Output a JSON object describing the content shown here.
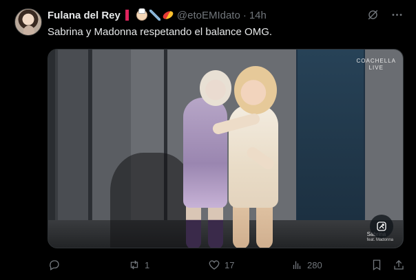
{
  "tweet": {
    "author": {
      "display_name": "Fulana del Rey",
      "name_emojis": [
        "red-boot",
        "nurse-face",
        "syringe",
        "pill"
      ],
      "handle": "@etoEMIdato",
      "separator": "·",
      "time": "14h"
    },
    "text": "Sabrina y Madonna respetando el balance OMG.",
    "media": {
      "watermark_top_line1": "COACHELLA",
      "watermark_top_line2": "LIVE",
      "watermark_bottom_line1": "Sabrina",
      "watermark_bottom_line2": "feat. Madonna",
      "alt_button_icon": "image-description-icon"
    },
    "actions": {
      "reply_count": "",
      "retweet_count": "1",
      "like_count": "17",
      "views_count": "280"
    }
  },
  "colors": {
    "background": "#000000",
    "text_primary": "#e7e9ea",
    "text_secondary": "#71767b",
    "border": "#2f3336"
  }
}
